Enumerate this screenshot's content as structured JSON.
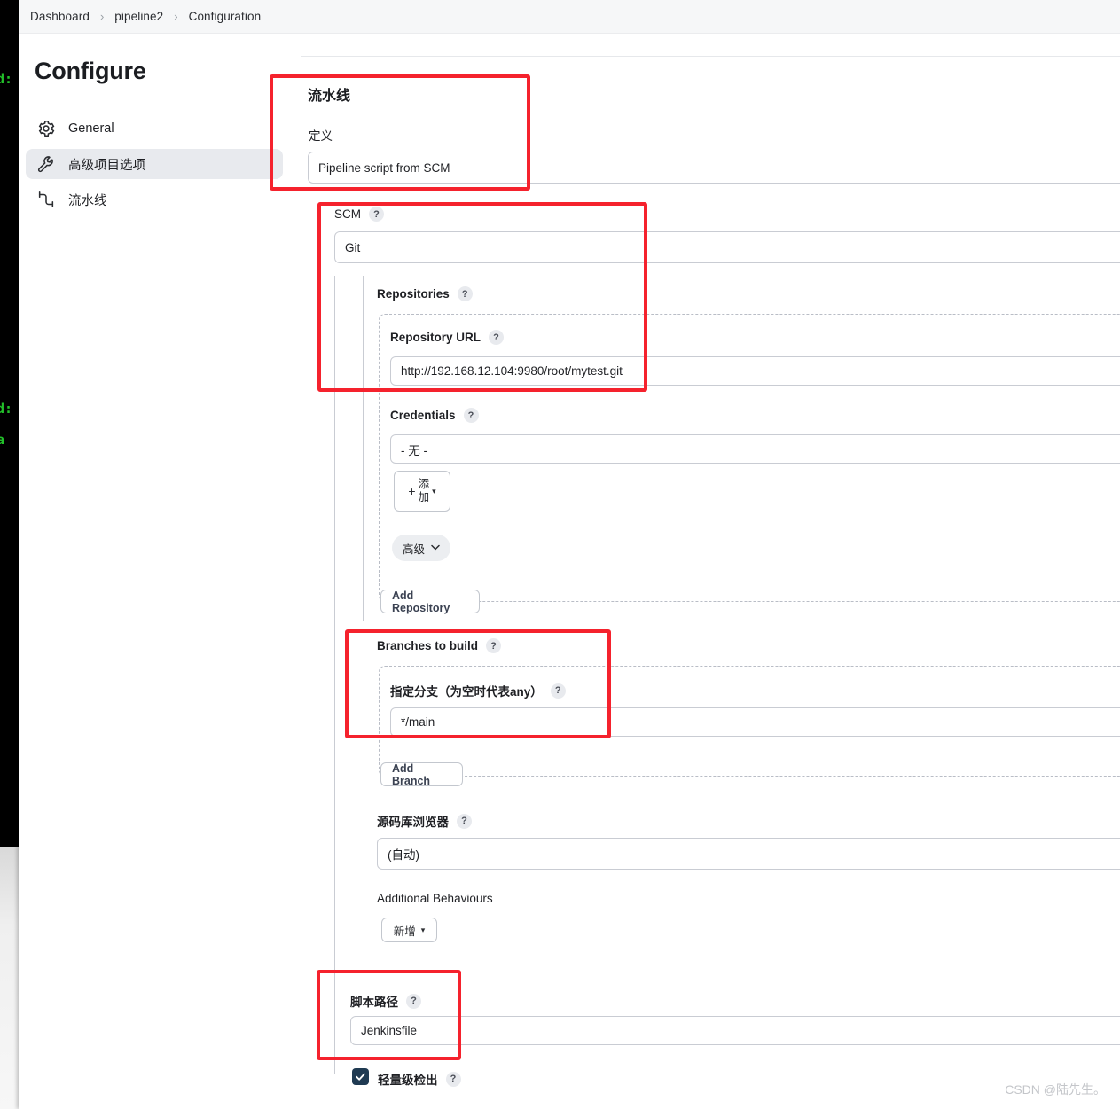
{
  "background": {
    "terminal_lines": [
      "d:",
      "d:",
      "a"
    ]
  },
  "breadcrumb": {
    "items": [
      {
        "label": "Dashboard"
      },
      {
        "label": "pipeline2"
      },
      {
        "label": "Configuration"
      }
    ],
    "separator": "›"
  },
  "page": {
    "title": "Configure"
  },
  "sidebar": {
    "items": [
      {
        "label": "General",
        "icon": "gear-icon",
        "active": false
      },
      {
        "label": "高级项目选项",
        "icon": "wrench-icon",
        "active": true
      },
      {
        "label": "流水线",
        "icon": "pipeline-icon",
        "active": false
      }
    ]
  },
  "pipeline_section": {
    "title": "流水线",
    "definition_label": "定义",
    "definition_value": "Pipeline script from SCM"
  },
  "scm_section": {
    "label": "SCM",
    "help": "?",
    "value": "Git",
    "repositories": {
      "label": "Repositories",
      "help": "?",
      "repository_url": {
        "label": "Repository URL",
        "help": "?",
        "value": "http://192.168.12.104:9980/root/mytest.git"
      },
      "credentials": {
        "label": "Credentials",
        "help": "?",
        "value": "- 无 -"
      },
      "add_button": {
        "plus": "+",
        "label_line1": "添",
        "label_line2": "加",
        "caret": "▾"
      },
      "advanced_button": {
        "label": "高级",
        "caret": "⌄"
      }
    },
    "add_repository_button": "Add Repository",
    "branches": {
      "label": "Branches to build",
      "help": "?",
      "branch_specifier": {
        "label": "指定分支（为空时代表any）",
        "help": "?",
        "value": "*/main"
      },
      "add_branch_button": "Add Branch"
    },
    "repository_browser": {
      "label": "源码库浏览器",
      "help": "?",
      "value": "(自动)"
    },
    "additional_behaviours": {
      "label": "Additional Behaviours",
      "add_button": "新增",
      "caret": "▾"
    },
    "script_path": {
      "label": "脚本路径",
      "help": "?",
      "value": "Jenkinsfile"
    },
    "lightweight_checkout": {
      "label": "轻量级检出",
      "help": "?",
      "checked": true
    }
  },
  "annotations": {
    "accent_color": "#f5222d",
    "boxes": [
      {
        "name": "pipeline-definition-highlight"
      },
      {
        "name": "scm-repository-highlight"
      },
      {
        "name": "branches-to-build-highlight"
      },
      {
        "name": "script-path-highlight"
      }
    ]
  },
  "watermark": {
    "text": "CSDN @陆先生。"
  }
}
